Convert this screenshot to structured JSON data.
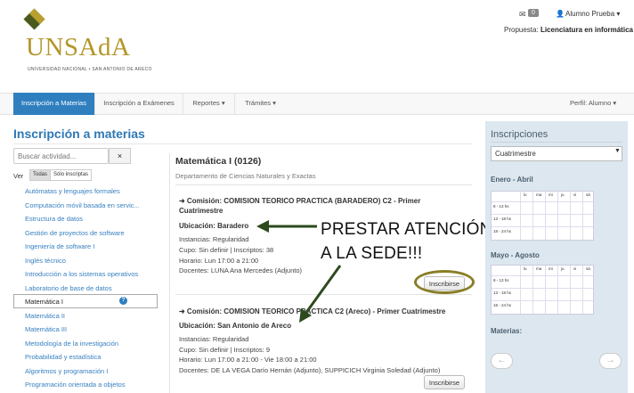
{
  "header": {
    "logo_text": "UNSAdA",
    "logo_subtitle": "UNIVERSIDAD NACIONAL • SAN ANTONIO DE ARECO",
    "messages_count": "0",
    "user_name": "Alumno Prueba",
    "propuesta_label": "Propuesta:",
    "propuesta_value": "Licenciatura en informática"
  },
  "nav": {
    "items": [
      {
        "label": "Inscripción a Materias",
        "active": true
      },
      {
        "label": "Inscripción a Exámenes"
      },
      {
        "label": "Reportes ▾"
      },
      {
        "label": "Trámites ▾"
      }
    ],
    "perfil": "Perfil: Alumno ▾"
  },
  "left": {
    "page_title": "Inscripción a materias",
    "search_placeholder": "Buscar actividad...",
    "clear_icon": "×",
    "ver_label": "Ver",
    "filter_all": "Todas",
    "filter_enrolled": "Sólo inscriptas",
    "activities": [
      "Autómatas y lenguajes formales",
      "Computación móvil basada en servic...",
      "Estructura de datos",
      "Gestión de proyectos de software",
      "Ingeniería de software I",
      "Inglés técnico",
      "Introducción a los sistemas operativos",
      "Laboratorio de base de datos",
      "Matemática I",
      "Matemática II",
      "Matemática III",
      "Metodología de la investigación",
      "Probabilidad y estadística",
      "Algoritmos y programación I",
      "Programación orientada a objetos"
    ],
    "selected_index": 8
  },
  "content": {
    "course_title": "Matemática I (0126)",
    "department": "Departamento de Ciencias Naturales y Exactas",
    "commissions": [
      {
        "title": "➜ Comisión: COMISION TEORICO PRACTICA (BARADERO) C2 - Primer Cuatrimestre",
        "location": "Ubicación: Baradero",
        "instances": "Instancias: Regularidad",
        "quota": "Cupo: Sin definir | Inscriptos: 38",
        "schedule": "Horario: Lun 17:00 a 21:00",
        "teachers": "Docentes: LUNA Ana Mercedes (Adjunto)",
        "button": "Inscribirse"
      },
      {
        "title": "➜ Comisión: COMISION TEORICO PRACTICA C2 (Areco) - Primer Cuatrimestre",
        "location": "Ubicación: San Antonio de Areco",
        "instances": "Instancias: Regularidad",
        "quota": "Cupo: Sin definir | Inscriptos: 9",
        "schedule": "Horario: Lun 17:00 a 21:00 - Vie 18:00 a 21:00",
        "teachers": "Docentes: DE LA VEGA Darío Hernán (Adjunto), SUPPICICH Virginia Soledad (Adjunto)",
        "button": "Inscribirse"
      }
    ],
    "annotation_line1": "PRESTAR ATENCIÓN",
    "annotation_line2": "A LA SEDE!!!"
  },
  "right": {
    "title": "Inscripciones",
    "period_select": "Cuatrimestre",
    "section1": "Enero - Abril",
    "section2": "Mayo - Agosto",
    "days": [
      "lu",
      "ma",
      "mi",
      "ju",
      "vi",
      "sá"
    ],
    "slots": [
      "8 - 13 hs",
      "13 - 18 hs",
      "18 - 24 hs"
    ],
    "materias_label": "Materias:",
    "prev": "←",
    "next": "→"
  },
  "colors": {
    "primary": "#2f7fbf",
    "logo_gold": "#b3962a",
    "logo_green": "#4a5a1f",
    "annotation_arrow": "#2d4a1e"
  }
}
